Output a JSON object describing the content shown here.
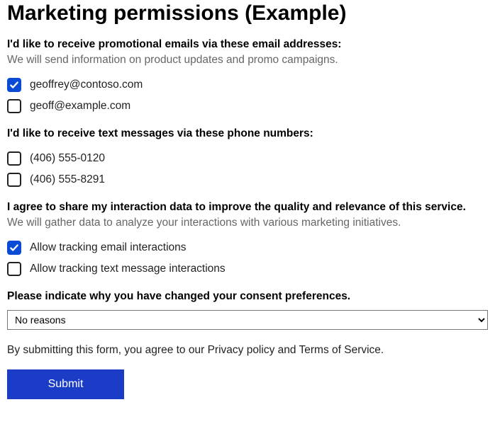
{
  "title": "Marketing permissions (Example)",
  "emails": {
    "heading": "I'd like to receive promotional emails via these email addresses:",
    "sub": "We will send information on product updates and promo campaigns.",
    "items": [
      {
        "label": "geoffrey@contoso.com",
        "checked": true
      },
      {
        "label": "geoff@example.com",
        "checked": false
      }
    ]
  },
  "phones": {
    "heading": "I'd like to receive text messages via these phone numbers:",
    "items": [
      {
        "label": "(406) 555-0120",
        "checked": false
      },
      {
        "label": "(406) 555-8291",
        "checked": false
      }
    ]
  },
  "tracking": {
    "heading": "I agree to share my interaction data to improve the quality and relevance of this service.",
    "sub": "We will gather data to analyze your interactions with various marketing initiatives.",
    "items": [
      {
        "label": "Allow tracking email interactions",
        "checked": true
      },
      {
        "label": "Allow tracking text message interactions",
        "checked": false
      }
    ]
  },
  "reason": {
    "heading": "Please indicate why you have changed your consent preferences.",
    "selected": "No reasons"
  },
  "consent_note": "By submitting this form, you agree to our Privacy policy and Terms of Service.",
  "submit_label": "Submit"
}
